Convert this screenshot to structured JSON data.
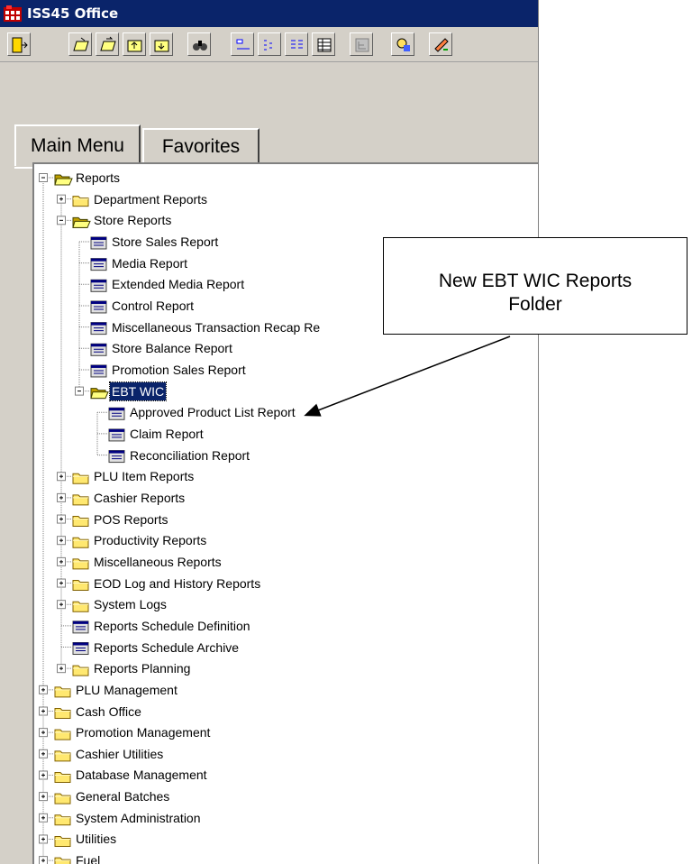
{
  "window": {
    "title": "ISS45 Office"
  },
  "toolbar": {
    "buttons": [
      "exit-icon",
      "open-icon",
      "forward-icon",
      "folder-up-icon",
      "folder-down-icon",
      "find-icon",
      "large-icons-icon",
      "small-icons-icon",
      "list-icon",
      "details-icon",
      "tree-icon",
      "help-icon",
      "edit-icon"
    ]
  },
  "tabs": [
    {
      "label": "Main Menu",
      "active": true
    },
    {
      "label": "Favorites",
      "active": false
    }
  ],
  "tree": {
    "items": [
      {
        "label": "Reports",
        "level": 0,
        "type": "folder-open",
        "expander": "minus"
      },
      {
        "label": "Department Reports",
        "level": 1,
        "type": "folder",
        "expander": "plus"
      },
      {
        "label": "Store Reports",
        "level": 1,
        "type": "folder-open",
        "expander": "minus"
      },
      {
        "label": "Store Sales Report",
        "level": 2,
        "type": "report"
      },
      {
        "label": "Media Report",
        "level": 2,
        "type": "report"
      },
      {
        "label": "Extended Media Report",
        "level": 2,
        "type": "report"
      },
      {
        "label": "Control Report",
        "level": 2,
        "type": "report"
      },
      {
        "label": "Miscellaneous Transaction Recap Re",
        "level": 2,
        "type": "report"
      },
      {
        "label": "Store Balance Report",
        "level": 2,
        "type": "report"
      },
      {
        "label": "Promotion Sales Report",
        "level": 2,
        "type": "report"
      },
      {
        "label": "EBT WIC",
        "level": 2,
        "type": "folder-open",
        "expander": "minus",
        "selected": true
      },
      {
        "label": "Approved Product List Report",
        "level": 3,
        "type": "report"
      },
      {
        "label": "Claim Report",
        "level": 3,
        "type": "report"
      },
      {
        "label": "Reconciliation Report",
        "level": 3,
        "type": "report"
      },
      {
        "label": "PLU Item Reports",
        "level": 1,
        "type": "folder",
        "expander": "plus"
      },
      {
        "label": "Cashier Reports",
        "level": 1,
        "type": "folder",
        "expander": "plus"
      },
      {
        "label": "POS Reports",
        "level": 1,
        "type": "folder",
        "expander": "plus"
      },
      {
        "label": "Productivity Reports",
        "level": 1,
        "type": "folder",
        "expander": "plus"
      },
      {
        "label": "Miscellaneous Reports",
        "level": 1,
        "type": "folder",
        "expander": "plus"
      },
      {
        "label": "EOD Log and History Reports",
        "level": 1,
        "type": "folder",
        "expander": "plus"
      },
      {
        "label": "System Logs",
        "level": 1,
        "type": "folder",
        "expander": "plus"
      },
      {
        "label": "Reports Schedule Definition",
        "level": 1,
        "type": "report"
      },
      {
        "label": "Reports Schedule Archive",
        "level": 1,
        "type": "report"
      },
      {
        "label": "Reports Planning",
        "level": 1,
        "type": "folder",
        "expander": "plus"
      },
      {
        "label": "PLU Management",
        "level": 0,
        "type": "folder",
        "expander": "plus"
      },
      {
        "label": "Cash Office",
        "level": 0,
        "type": "folder",
        "expander": "plus"
      },
      {
        "label": "Promotion Management",
        "level": 0,
        "type": "folder",
        "expander": "plus"
      },
      {
        "label": "Cashier Utilities",
        "level": 0,
        "type": "folder",
        "expander": "plus"
      },
      {
        "label": "Database Management",
        "level": 0,
        "type": "folder",
        "expander": "plus"
      },
      {
        "label": "General Batches",
        "level": 0,
        "type": "folder",
        "expander": "plus"
      },
      {
        "label": "System Administration",
        "level": 0,
        "type": "folder",
        "expander": "plus"
      },
      {
        "label": "Utilities",
        "level": 0,
        "type": "folder",
        "expander": "plus"
      },
      {
        "label": "Fuel",
        "level": 0,
        "type": "folder",
        "expander": "plus"
      }
    ]
  },
  "callout": {
    "line1": "New EBT WIC Reports",
    "line2": "Folder"
  }
}
